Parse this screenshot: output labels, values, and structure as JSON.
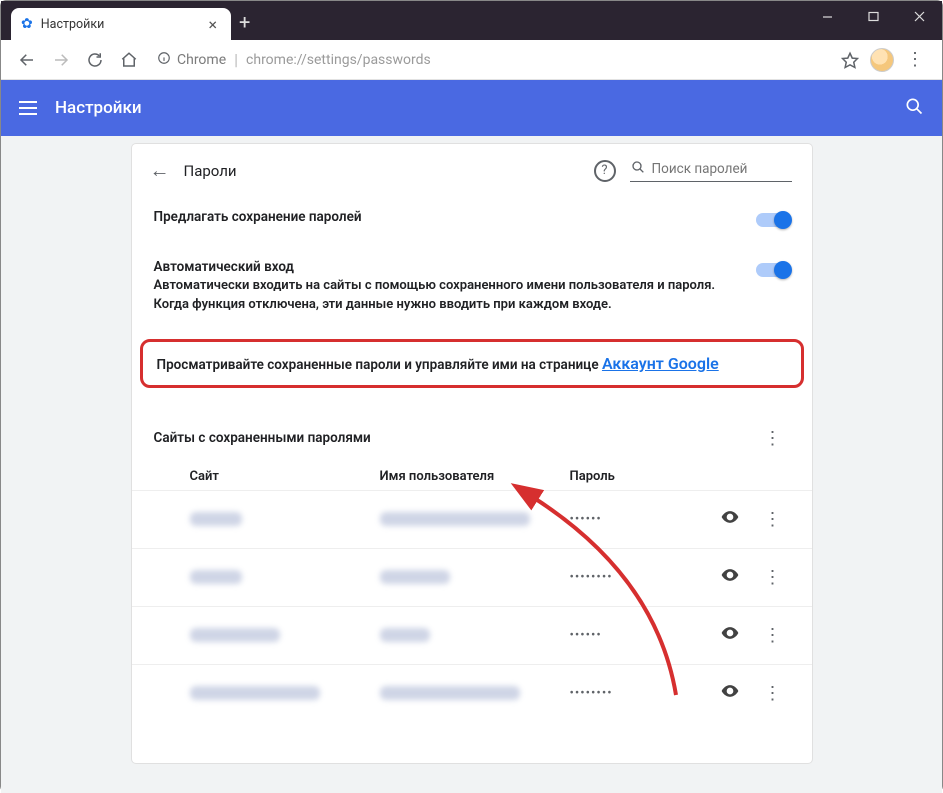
{
  "window": {
    "tab_title": "Настройки"
  },
  "addr": {
    "scheme": "Chrome",
    "path": "chrome://settings/passwords"
  },
  "header": {
    "title": "Настройки"
  },
  "section": {
    "title": "Пароли",
    "search_placeholder": "Поиск паролей"
  },
  "toggles": {
    "offer_save": {
      "label": "Предлагать сохранение паролей"
    },
    "auto_signin": {
      "label": "Автоматический вход",
      "desc": "Автоматически входить на сайты с помощью сохраненного имени пользователя и пароля. Когда функция отключена, эти данные нужно вводить при каждом входе."
    }
  },
  "manage": {
    "text": "Просматривайте сохраненные пароли и управляйте ими на странице ",
    "link": "Аккаунт Google"
  },
  "saved": {
    "heading": "Сайты с сохраненными паролями",
    "cols": {
      "site": "Сайт",
      "user": "Имя пользователя",
      "pwd": "Пароль"
    },
    "rows": [
      {
        "pwd": "••••••"
      },
      {
        "pwd": "••••••••"
      },
      {
        "pwd": "••••••"
      },
      {
        "pwd": "••••••••"
      }
    ]
  }
}
